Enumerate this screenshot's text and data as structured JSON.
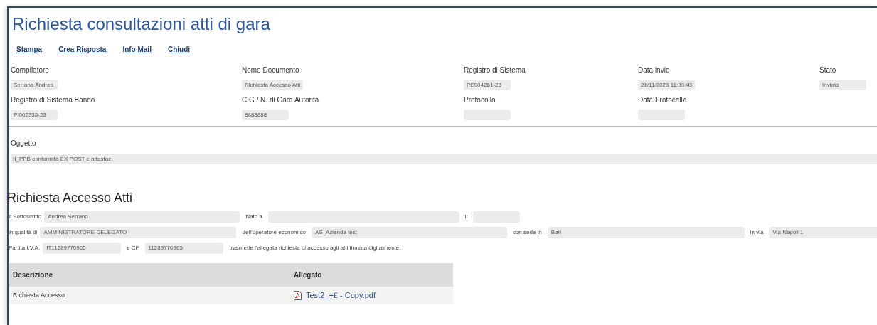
{
  "title": "Richiesta consultazioni atti di gara",
  "toolbar": [
    "Stampa",
    "Crea Risposta",
    "Info Mail",
    "Chiudi"
  ],
  "header_fields": [
    {
      "label": "Compilatore",
      "value": "Serrano Andrea"
    },
    {
      "label": "Nome Documento",
      "value": "Richiesta Accesso Atti"
    },
    {
      "label": "Registro di Sistema",
      "value": "PE004261-23"
    },
    {
      "label": "Data invio",
      "value": "21/11/2023 11:39:43"
    },
    {
      "label": "Stato",
      "value": "Inviato"
    },
    {
      "label": "Registro di Sistema Bando",
      "value": "PI002335-23"
    },
    {
      "label": "CIG / N. di Gara Autorità",
      "value": "8888888"
    },
    {
      "label": "Protocollo"
    },
    {
      "label": "Data Protocollo"
    }
  ],
  "oggetto": {
    "label": "Oggetto",
    "value": "II_PPB conformità EX POST e attestaz."
  },
  "section_title": "Richiesta Accesso Atti",
  "form_rows": [
    [
      {
        "label": "Il Sottoscritto",
        "value": "Andrea Serrano"
      },
      {
        "label": "Nato a"
      },
      {
        "label": "il"
      }
    ],
    [
      {
        "label": "in qualità di",
        "value": "AMMINISTRATORE DELEGATO"
      },
      {
        "label": "dell’operatore economico",
        "value": "AS_Azienda test"
      },
      {
        "label": "con sede in",
        "value": "Bari"
      },
      {
        "label": "in via",
        "value": "Via Napoli 1"
      }
    ],
    [
      {
        "label": "Partita I.V.A.",
        "value": "IT11289770965"
      },
      {
        "label": "e CF",
        "value": "11289770965"
      }
    ]
  ],
  "statement": "trasmette l’allegata richiesta di accesso agli atti firmata digitalmente.",
  "table": {
    "columns": [
      "Descrizione",
      "Allegato"
    ],
    "rows": [
      {
        "descrizione": "Richiesta Accesso",
        "allegato": "Test2_+£ - Copy.pdf"
      }
    ]
  }
}
